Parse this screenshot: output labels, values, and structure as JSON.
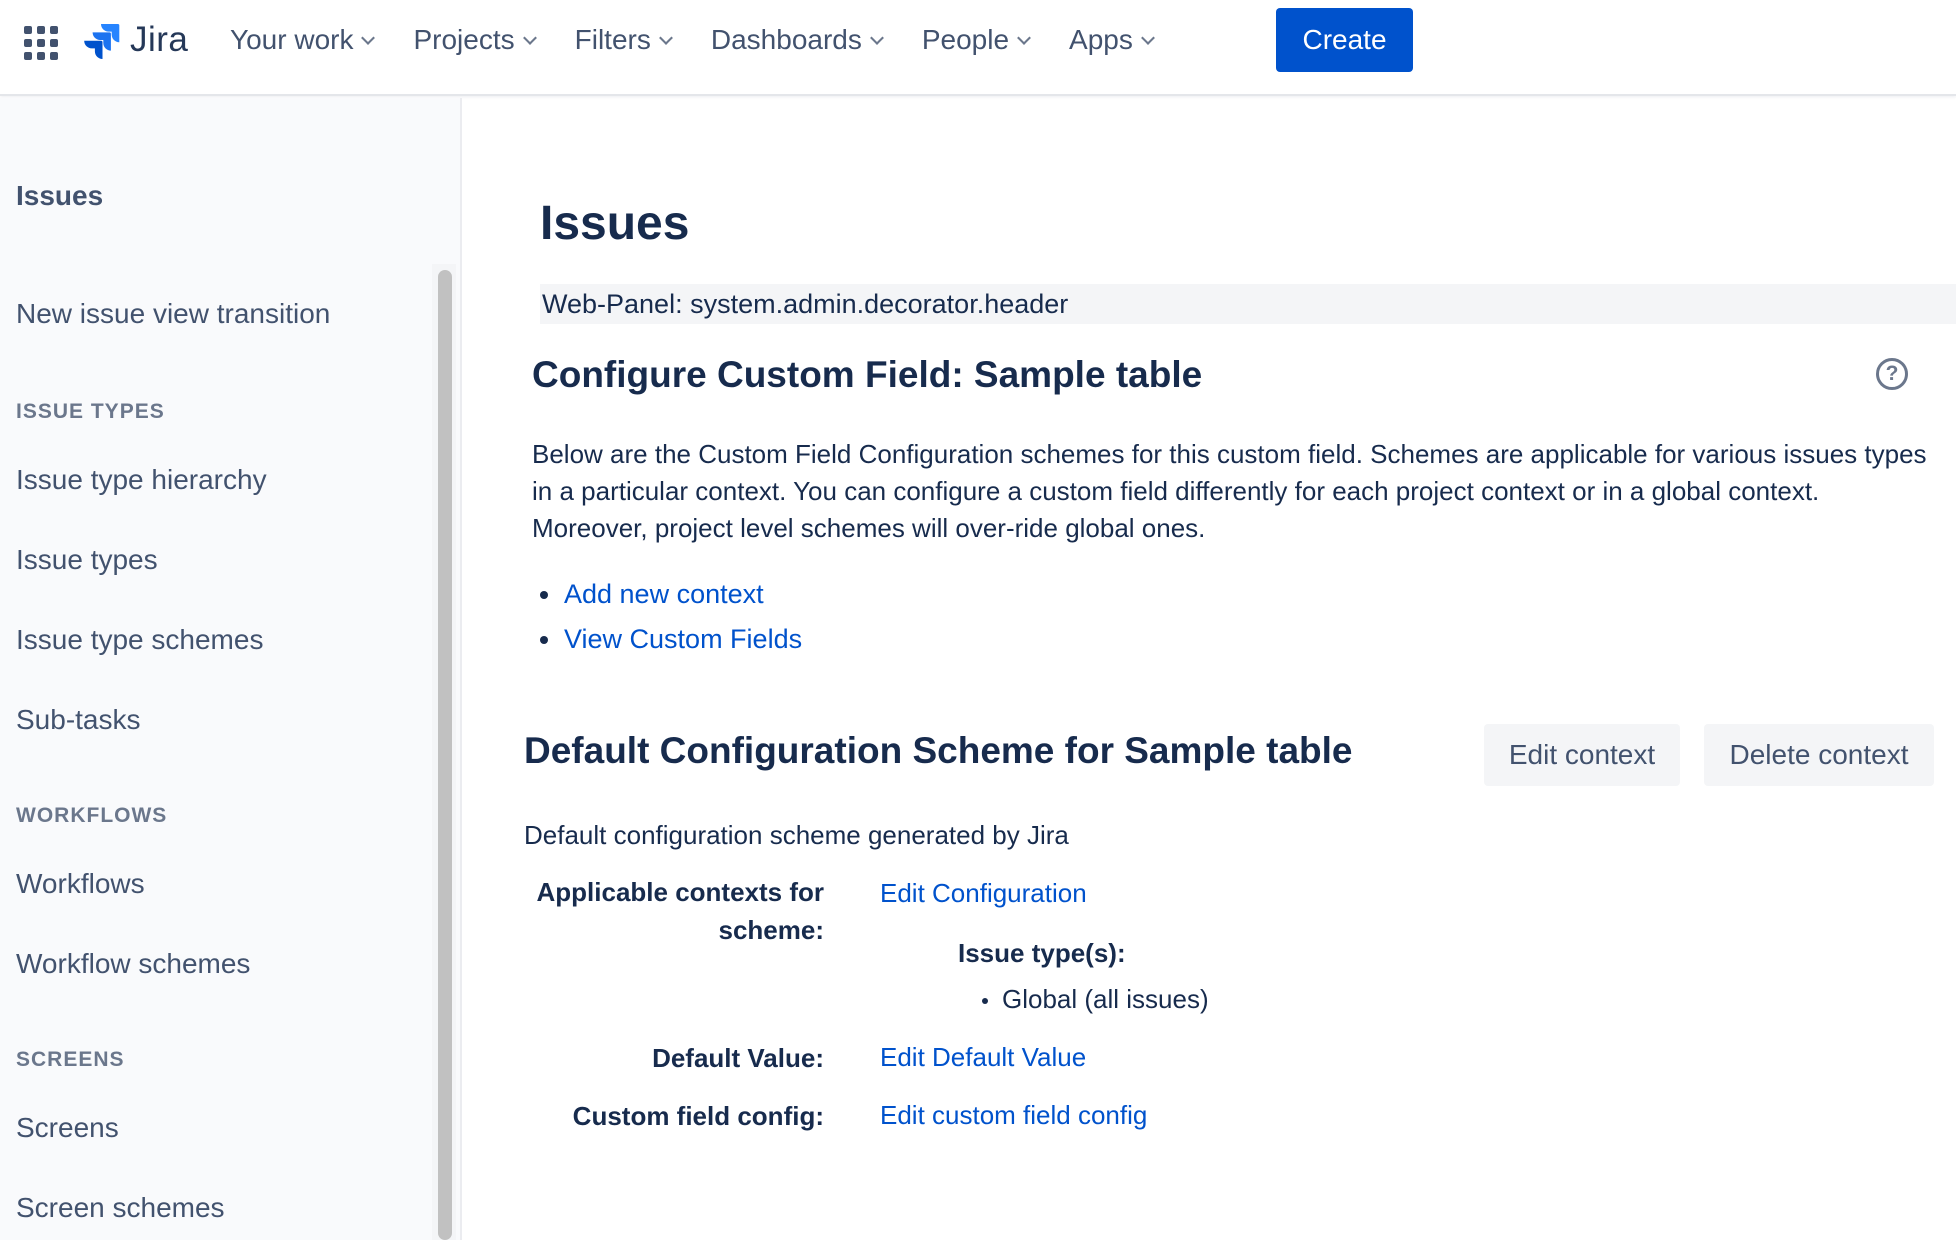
{
  "topnav": {
    "logo_text": "Jira",
    "items": [
      {
        "label": "Your work"
      },
      {
        "label": "Projects"
      },
      {
        "label": "Filters"
      },
      {
        "label": "Dashboards"
      },
      {
        "label": "People"
      },
      {
        "label": "Apps"
      }
    ],
    "create_label": "Create",
    "colors": {
      "primary": "#0052cc",
      "logo": "#2684ff"
    }
  },
  "sidebar": {
    "title": "Issues",
    "items": {
      "new_issue_view": "New issue view transition",
      "issue_types_header": "ISSUE TYPES",
      "issue_type_hierarchy": "Issue type hierarchy",
      "issue_types": "Issue types",
      "issue_type_schemes": "Issue type schemes",
      "sub_tasks": "Sub-tasks",
      "workflows_header": "WORKFLOWS",
      "workflows": "Workflows",
      "workflow_schemes": "Workflow schemes",
      "screens_header": "SCREENS",
      "screens": "Screens",
      "screen_schemes": "Screen schemes"
    }
  },
  "main": {
    "page_title": "Issues",
    "web_panel": "Web-Panel: system.admin.decorator.header",
    "configure_title": "Configure Custom Field: Sample table",
    "description": "Below are the Custom Field Configuration schemes for this custom field. Schemes are applicable for various issues types in a particular context. You can configure a custom field differently for each project context or in a global context. Moreover, project level schemes will over-ride global ones.",
    "links": {
      "add_context": "Add new context",
      "view_custom_fields": "View Custom Fields"
    },
    "scheme": {
      "title": "Default Configuration Scheme for Sample table",
      "edit_context": "Edit context",
      "delete_context": "Delete context",
      "description": "Default configuration scheme generated by Jira",
      "applicable_label_1": "Applicable contexts for",
      "applicable_label_2": "scheme:",
      "edit_configuration": "Edit Configuration",
      "issue_types_label": "Issue type(s):",
      "issue_type_value": "Global (all issues)",
      "default_value_label": "Default Value:",
      "edit_default_value": "Edit Default Value",
      "custom_field_config_label": "Custom field config:",
      "edit_custom_field_config": "Edit custom field config"
    }
  }
}
